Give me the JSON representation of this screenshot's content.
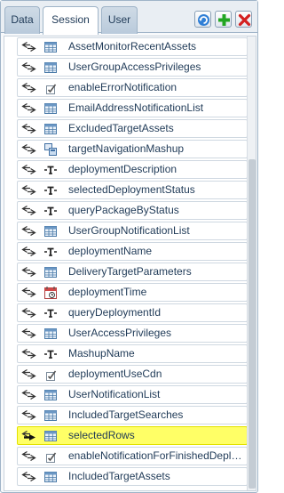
{
  "tabs": [
    {
      "label": "Data",
      "active": false
    },
    {
      "label": "Session",
      "active": true
    },
    {
      "label": "User",
      "active": false
    }
  ],
  "toolbar": {
    "refresh_icon": "refresh-icon",
    "add_icon": "add-icon",
    "delete_icon": "delete-icon"
  },
  "colors": {
    "highlight": "#ffff66",
    "add_green": "#22a622",
    "delete_red": "#d42020",
    "refresh_blue": "#2f7fd6"
  },
  "items": [
    {
      "label": "AssetMonitorRecentAssets",
      "icon": "table-icon"
    },
    {
      "label": "UserGroupAccessPrivileges",
      "icon": "table-icon"
    },
    {
      "label": "enableErrorNotification",
      "icon": "checkbox-icon"
    },
    {
      "label": "EmailAddressNotificationList",
      "icon": "table-icon"
    },
    {
      "label": "ExcludedTargetAssets",
      "icon": "table-icon"
    },
    {
      "label": "targetNavigationMashup",
      "icon": "mashup-icon"
    },
    {
      "label": "deploymentDescription",
      "icon": "text-icon"
    },
    {
      "label": "selectedDeploymentStatus",
      "icon": "text-icon"
    },
    {
      "label": "queryPackageByStatus",
      "icon": "text-icon"
    },
    {
      "label": "UserGroupNotificationList",
      "icon": "table-icon"
    },
    {
      "label": "deploymentName",
      "icon": "text-icon"
    },
    {
      "label": "DeliveryTargetParameters",
      "icon": "table-icon"
    },
    {
      "label": "deploymentTime",
      "icon": "calendar-icon"
    },
    {
      "label": "queryDeploymentId",
      "icon": "text-icon"
    },
    {
      "label": "UserAccessPrivileges",
      "icon": "table-icon"
    },
    {
      "label": "MashupName",
      "icon": "text-icon"
    },
    {
      "label": "deploymentUseCdn",
      "icon": "checkbox-icon"
    },
    {
      "label": "UserNotificationList",
      "icon": "table-icon"
    },
    {
      "label": "IncludedTargetSearches",
      "icon": "table-icon"
    },
    {
      "label": "selectedRows",
      "icon": "table-icon",
      "highlighted": true
    },
    {
      "label": "enableNotificationForFinishedDeployme...",
      "icon": "checkbox-icon"
    },
    {
      "label": "IncludedTargetAssets",
      "icon": "table-icon"
    }
  ],
  "scroll": {
    "position": 0.28
  }
}
